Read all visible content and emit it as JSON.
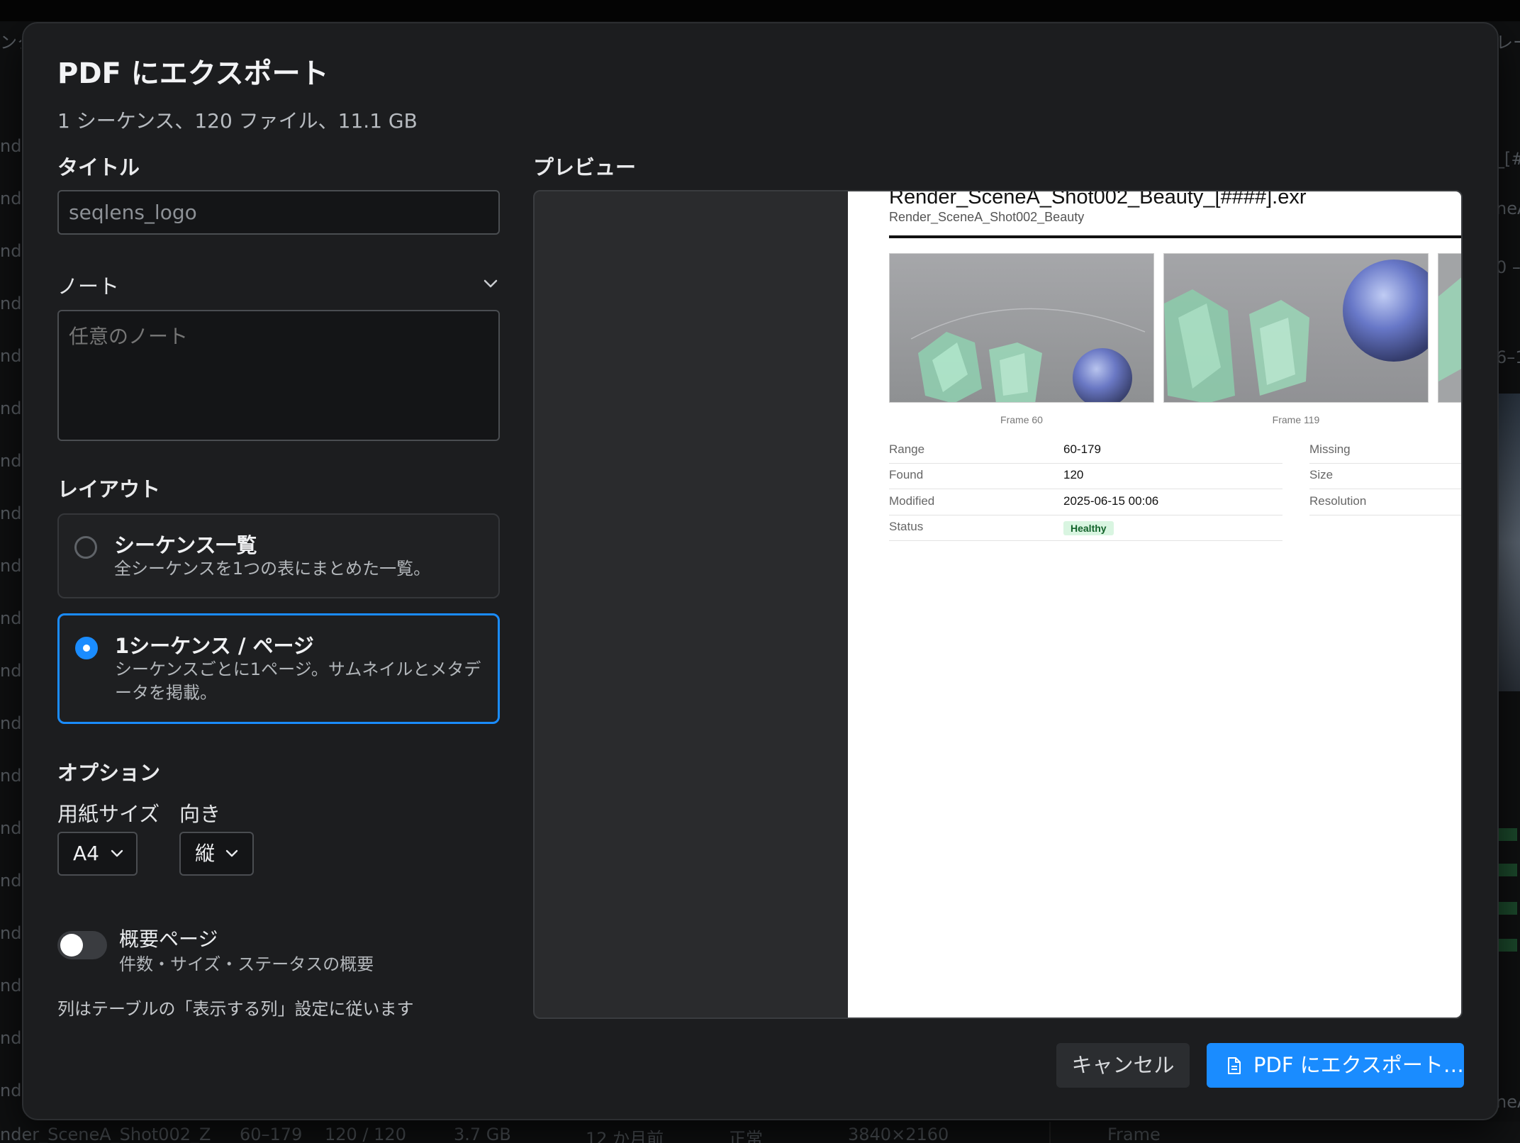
{
  "background": {
    "left_labels": [
      "ンク",
      "nd",
      "nd",
      "nd",
      "nd",
      "nd",
      "nd",
      "nd",
      "nd",
      "nd",
      "nd",
      "nd",
      "nd",
      "nd",
      "nd",
      "nd",
      "nd",
      "nd",
      "nd",
      "nd",
      "nd"
    ],
    "right_labels": [
      "レー",
      "_[#",
      "neA",
      "0 –",
      "6–1",
      "neA"
    ],
    "bottom_row": [
      "nder_SceneA_Shot002_Z",
      "60–179",
      "120 / 120",
      "3.7 GB",
      "12 か月前",
      "正常",
      "3840×2160"
    ],
    "bottom_right_label": "Frame"
  },
  "dialog": {
    "title": "PDF にエクスポート",
    "summary": "1 シーケンス、120 ファイル、11.1 GB",
    "title_label": "タイトル",
    "title_value": "seqlens_logo",
    "note_label": "ノート",
    "note_placeholder": "任意のノート",
    "layout_label": "レイアウト",
    "layouts": [
      {
        "title": "シーケンス一覧",
        "desc": "全シーケンスを1つの表にまとめた一覧。",
        "selected": false
      },
      {
        "title": "1シーケンス / ページ",
        "desc": "シーケンスごとに1ページ。サムネイルとメタデータを掲載。",
        "selected": true
      }
    ],
    "options_label": "オプション",
    "paper_size_label": "用紙サイズ",
    "paper_size_value": "A4",
    "orientation_label": "向き",
    "orientation_value": "縦",
    "summary_toggle_title": "概要ページ",
    "summary_toggle_desc": "件数・サイズ・ステータスの概要",
    "summary_toggle_on": false,
    "columns_note": "列はテーブルの「表示する列」設定に従います",
    "preview_label": "プレビュー",
    "cancel_label": "キャンセル",
    "export_label": "PDF にエクスポート…",
    "accent_color": "#1a8cff"
  },
  "preview": {
    "heading": "Render_SceneA_Shot002_Beauty_[####].exr",
    "subheading": "Render_SceneA_Shot002_Beauty",
    "thumbnails": [
      {
        "caption": "Frame 60"
      },
      {
        "caption": "Frame 119"
      }
    ],
    "meta_left": [
      {
        "key": "Range",
        "value": "60-179"
      },
      {
        "key": "Found",
        "value": "120"
      },
      {
        "key": "Modified",
        "value": "2025-06-15 00:06"
      },
      {
        "key": "Status",
        "value": "Healthy"
      }
    ],
    "meta_right": [
      {
        "key": "Missing"
      },
      {
        "key": "Size"
      },
      {
        "key": "Resolution"
      }
    ]
  }
}
